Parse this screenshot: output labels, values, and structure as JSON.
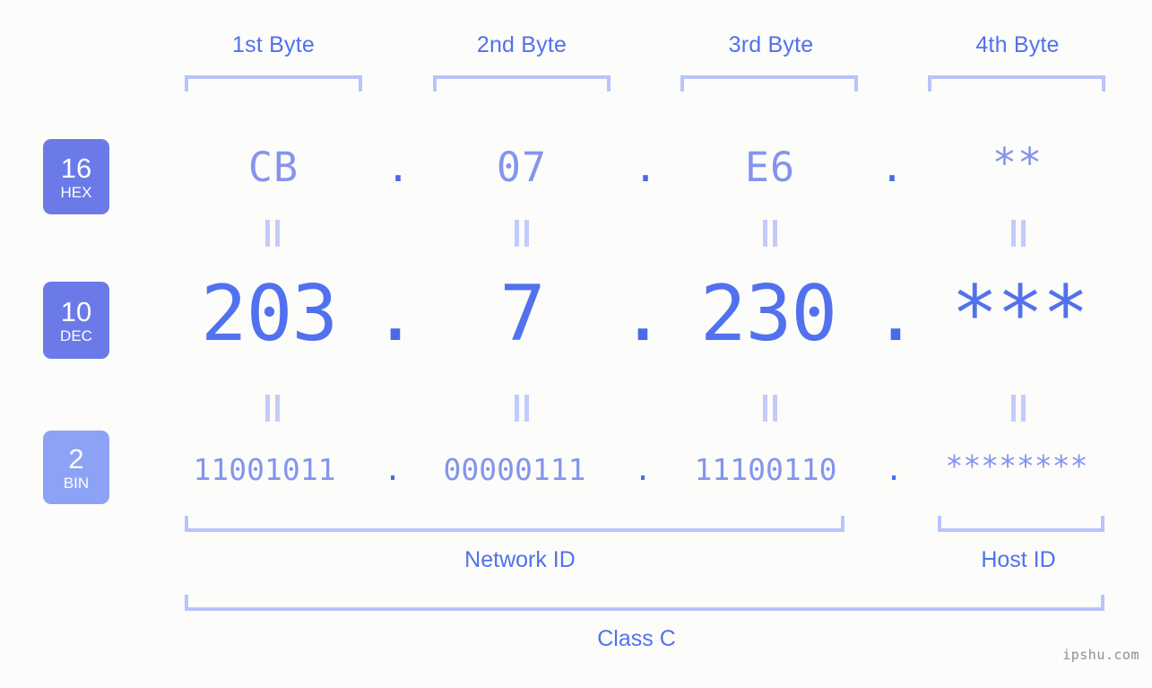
{
  "byte_headers": [
    {
      "label": "1st Byte"
    },
    {
      "label": "2nd Byte"
    },
    {
      "label": "3rd Byte"
    },
    {
      "label": "4th Byte"
    }
  ],
  "rows": [
    {
      "badge_number": "16",
      "badge_system": "HEX",
      "values": [
        "CB",
        "07",
        "E6",
        "**"
      ],
      "separator": "."
    },
    {
      "badge_number": "10",
      "badge_system": "DEC",
      "values": [
        "203",
        "7",
        "230",
        "***"
      ],
      "separator": "."
    },
    {
      "badge_number": "2",
      "badge_system": "BIN",
      "values": [
        "11001011",
        "00000111",
        "11100110",
        "********"
      ],
      "separator": "."
    }
  ],
  "sections": {
    "network_id": "Network ID",
    "host_id": "Host ID",
    "class": "Class C"
  },
  "watermark": "ipshu.com",
  "colors": {
    "background": "#fcfdfa",
    "badge_strong": "#6b7ae8",
    "badge_light": "#8ca3f5",
    "text_strong": "#5271ee",
    "text_light": "#8494ee",
    "bracket": "#b9c4fb",
    "equals": "#c3cbfb",
    "dot": "#4a6ae8",
    "watermark": "#8a8f96"
  }
}
